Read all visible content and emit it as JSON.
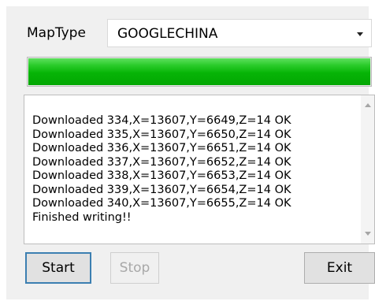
{
  "maptype": {
    "label": "MapType",
    "selected": "GOOGLECHINA"
  },
  "progress": {
    "value_percent": 100,
    "color": "#06b406"
  },
  "log": {
    "lines": [
      "Downloaded 334,X=13607,Y=6649,Z=14 OK",
      "Downloaded 335,X=13607,Y=6650,Z=14 OK",
      "Downloaded 336,X=13607,Y=6651,Z=14 OK",
      "Downloaded 337,X=13607,Y=6652,Z=14 OK",
      "Downloaded 338,X=13607,Y=6653,Z=14 OK",
      "Downloaded 339,X=13607,Y=6654,Z=14 OK",
      "Downloaded 340,X=13607,Y=6655,Z=14 OK",
      "Finished writing!!"
    ]
  },
  "buttons": {
    "start": "Start",
    "stop": "Stop",
    "exit": "Exit"
  }
}
